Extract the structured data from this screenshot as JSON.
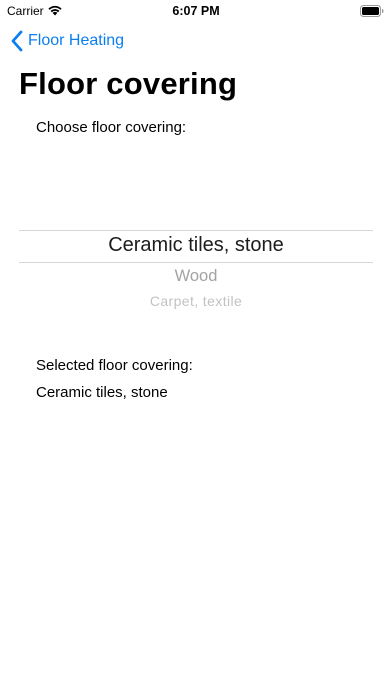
{
  "status_bar": {
    "carrier": "Carrier",
    "time": "6:07 PM",
    "wifi_icon": "wifi-icon",
    "battery_icon": "battery-icon"
  },
  "nav": {
    "back_label": "Floor Heating",
    "back_icon": "chevron-left-icon",
    "accent_color": "#0a7ff0"
  },
  "page": {
    "title": "Floor covering",
    "prompt": "Choose floor covering:"
  },
  "picker": {
    "options": [
      "Ceramic tiles, stone",
      "Wood",
      "Carpet, textile"
    ],
    "selected_index": 0
  },
  "result": {
    "label": "Selected floor covering:",
    "value": "Ceramic tiles, stone"
  }
}
